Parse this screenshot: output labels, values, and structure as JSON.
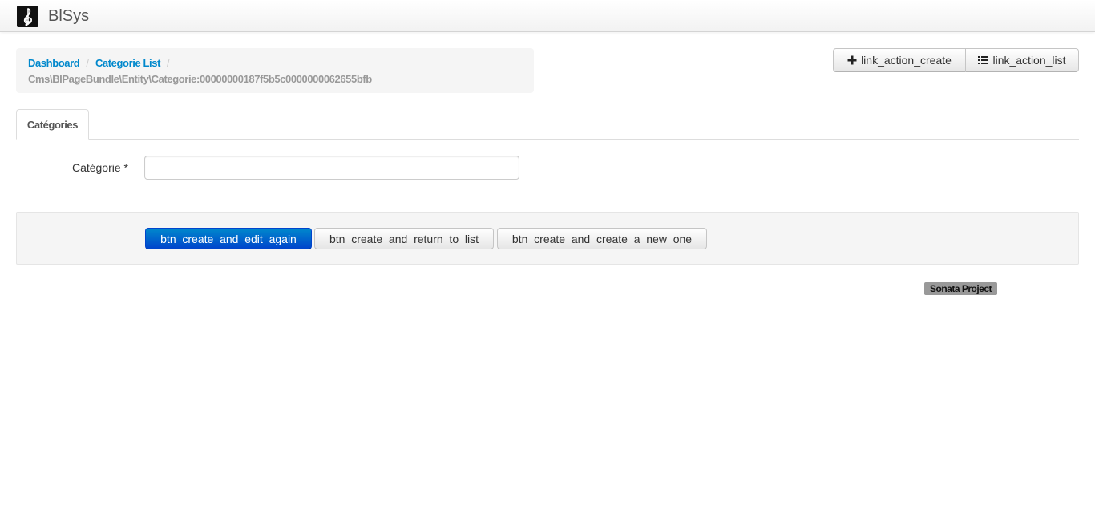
{
  "app": {
    "brand": "BlSys",
    "logo_icon": "treble-clef-icon"
  },
  "breadcrumb": {
    "items": [
      "Dashboard",
      "Categorie List"
    ],
    "separator": "/",
    "current": "Cms\\BlPageBundle\\Entity\\Categorie:00000000187f5b5c0000000062655bfb"
  },
  "actions": {
    "create_label": "link_action_create",
    "create_icon": "plus-icon",
    "list_label": "link_action_list",
    "list_icon": "list-icon"
  },
  "tabs": [
    {
      "label": "Catégories"
    }
  ],
  "form": {
    "fields": [
      {
        "label": "Catégorie *",
        "value": "",
        "placeholder": ""
      }
    ]
  },
  "form_actions": {
    "create_and_edit_again": "btn_create_and_edit_again",
    "create_and_return_to_list": "btn_create_and_return_to_list",
    "create_and_create_a_new_one": "btn_create_and_create_a_new_one"
  },
  "footer": {
    "badge": "Sonata Project"
  },
  "colors": {
    "link": "#0088cc",
    "primary": "#0055cc",
    "well": "#f5f5f5",
    "badge": "#999999"
  }
}
